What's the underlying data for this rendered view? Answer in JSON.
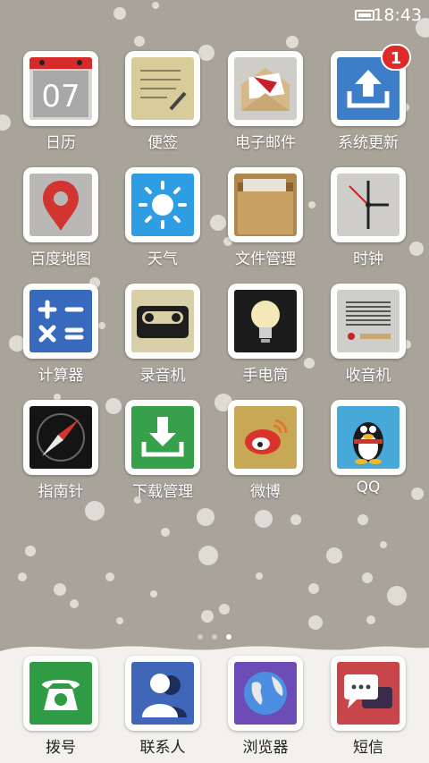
{
  "status_bar": {
    "time": "18:43",
    "battery_icon": "battery-icon"
  },
  "apps": [
    {
      "label": "日历",
      "icon": "calendar-icon",
      "date": "07"
    },
    {
      "label": "便签",
      "icon": "notes-icon"
    },
    {
      "label": "电子邮件",
      "icon": "email-icon"
    },
    {
      "label": "系统更新",
      "icon": "update-icon",
      "badge": "1"
    },
    {
      "label": "百度地图",
      "icon": "map-pin-icon"
    },
    {
      "label": "天气",
      "icon": "weather-sun-icon"
    },
    {
      "label": "文件管理",
      "icon": "folder-icon"
    },
    {
      "label": "时钟",
      "icon": "clock-icon"
    },
    {
      "label": "计算器",
      "icon": "calculator-icon"
    },
    {
      "label": "录音机",
      "icon": "cassette-icon"
    },
    {
      "label": "手电筒",
      "icon": "lightbulb-icon"
    },
    {
      "label": "收音机",
      "icon": "radio-icon"
    },
    {
      "label": "指南针",
      "icon": "compass-icon"
    },
    {
      "label": "下载管理",
      "icon": "download-icon"
    },
    {
      "label": "微博",
      "icon": "weibo-icon"
    },
    {
      "label": "QQ",
      "icon": "qq-penguin-icon"
    }
  ],
  "dock": [
    {
      "label": "拨号",
      "icon": "phone-icon"
    },
    {
      "label": "联系人",
      "icon": "contacts-icon"
    },
    {
      "label": "浏览器",
      "icon": "globe-icon"
    },
    {
      "label": "短信",
      "icon": "message-icon"
    }
  ],
  "page_indicator": {
    "pages": 3,
    "current": 3
  },
  "colors": {
    "background": "#a9a49a",
    "snow": "#f2f0ec",
    "badge": "#e02a2a"
  }
}
